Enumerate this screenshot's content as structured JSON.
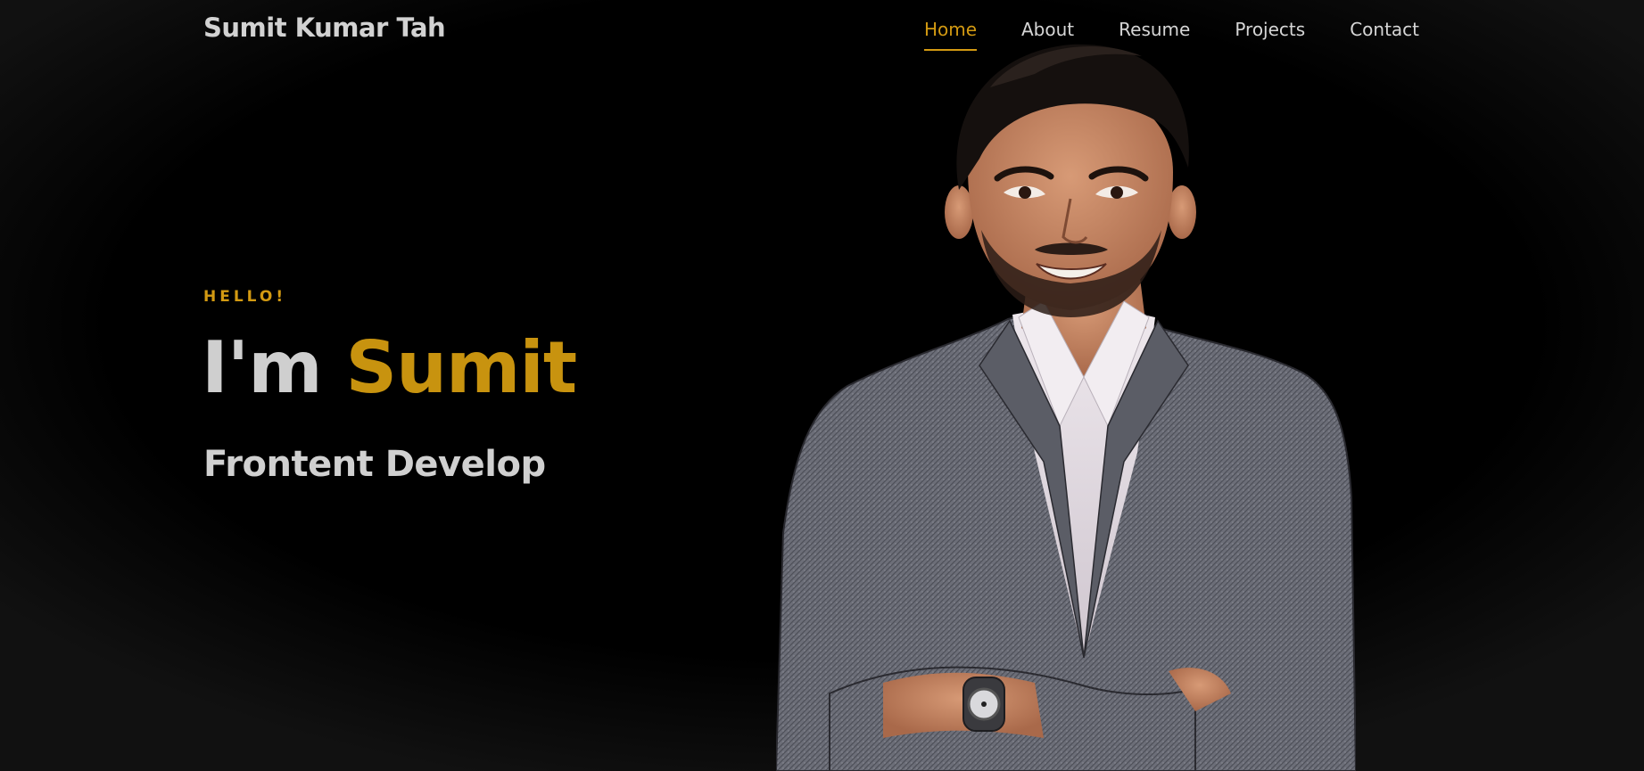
{
  "header": {
    "brand": "Sumit Kumar Tah",
    "nav": [
      {
        "label": "Home",
        "active": true
      },
      {
        "label": "About",
        "active": false
      },
      {
        "label": "Resume",
        "active": false
      },
      {
        "label": "Projects",
        "active": false
      },
      {
        "label": "Contact",
        "active": false
      }
    ]
  },
  "hero": {
    "greeting": "HELLO!",
    "headline_prefix": "I'm",
    "headline_name": "Sumit",
    "role": "Frontent Develop"
  },
  "colors": {
    "accent": "#d39a12",
    "background": "#000000",
    "text": "#d0d0d0"
  }
}
